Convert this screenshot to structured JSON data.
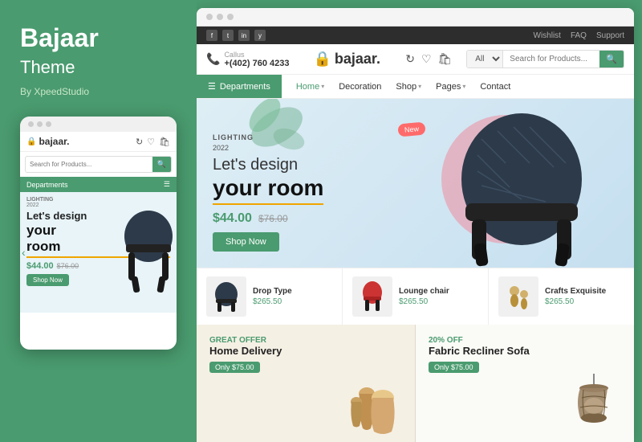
{
  "left": {
    "brand": "Bajaar",
    "sub": "Theme",
    "by": "By XpeedStudio",
    "mobile": {
      "search_placeholder": "Search for Products...",
      "dept_label": "Departments",
      "hero_tag": "LIGHTING",
      "hero_year": "2022",
      "hero_h1": "Let's design",
      "hero_h2": "your",
      "hero_h3": "room",
      "price": "$44.00",
      "old_price": "$76.00",
      "shop_btn": "Shop Now"
    }
  },
  "browser": {
    "dots": [
      "dot1",
      "dot2",
      "dot3"
    ],
    "topbar": {
      "social": [
        "f",
        "t",
        "in",
        "y"
      ],
      "links": [
        "Wishlist",
        "FAQ",
        "Support"
      ]
    },
    "header": {
      "phone_icon": "phone",
      "phone_label": "Callus",
      "phone_number": "+(402) 760 4233",
      "logo": "bajaar.",
      "icons": [
        "refresh",
        "heart",
        "cart"
      ],
      "search_cat": "All",
      "search_placeholder": "Search for Products...",
      "search_btn": "🔍"
    },
    "nav": {
      "dept_btn": "Departments",
      "links": [
        {
          "label": "Home",
          "has_arrow": true,
          "active": true
        },
        {
          "label": "Decoration",
          "has_arrow": false
        },
        {
          "label": "Shop",
          "has_arrow": true
        },
        {
          "label": "Pages",
          "has_arrow": true
        },
        {
          "label": "Contact",
          "has_arrow": false
        }
      ]
    },
    "hero": {
      "tag": "LIGHTING",
      "year": "2022",
      "title1": "Let's design",
      "title2": "your room",
      "price": "$44.00",
      "old_price": "$76.00",
      "shop_btn": "Shop Now",
      "new_badge": "New"
    },
    "products": [
      {
        "name": "Drop Type",
        "price": "$265.50"
      },
      {
        "name": "Lounge chair",
        "price": "$265.50"
      },
      {
        "name": "Crafts Exquisite",
        "price": "$265.50"
      }
    ],
    "banners": [
      {
        "offer": "Great Offer",
        "title": "Home Delivery",
        "tag_label": "Only $75.00"
      },
      {
        "offer": "20% off",
        "title": "Fabric Recliner Sofa",
        "tag_label": "Only $75.00"
      }
    ]
  }
}
